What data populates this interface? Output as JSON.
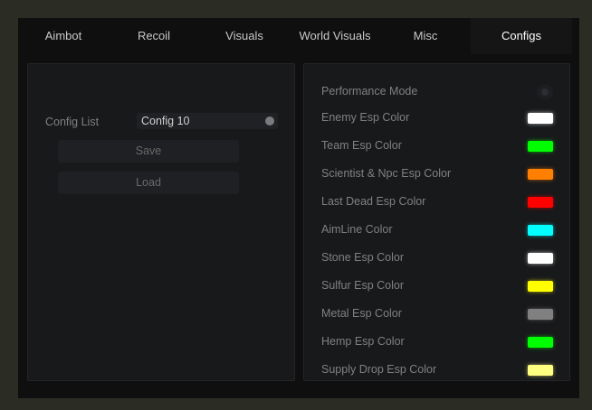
{
  "tabs": [
    "Aimbot",
    "Recoil",
    "Visuals",
    "World Visuals",
    "Misc",
    "Configs"
  ],
  "active_tab": "Configs",
  "config": {
    "list_label": "Config List",
    "selected": "Config 10",
    "save_label": "Save",
    "load_label": "Load"
  },
  "settings": {
    "performance_mode": {
      "label": "Performance Mode",
      "enabled": false
    },
    "colors": [
      {
        "label": "Enemy Esp Color",
        "color": "#ffffff"
      },
      {
        "label": "Team Esp Color",
        "color": "#00ff00"
      },
      {
        "label": "Scientist & Npc Esp Color",
        "color": "#ff8000"
      },
      {
        "label": "Last Dead Esp Color",
        "color": "#ff0000"
      },
      {
        "label": "AimLine Color",
        "color": "#00ffff"
      },
      {
        "label": "Stone Esp Color",
        "color": "#ffffff"
      },
      {
        "label": "Sulfur Esp Color",
        "color": "#ffff00"
      },
      {
        "label": "Metal Esp Color",
        "color": "#808080"
      },
      {
        "label": "Hemp Esp Color",
        "color": "#00ff00"
      },
      {
        "label": "Supply Drop Esp Color",
        "color": "#ffff80"
      }
    ]
  }
}
